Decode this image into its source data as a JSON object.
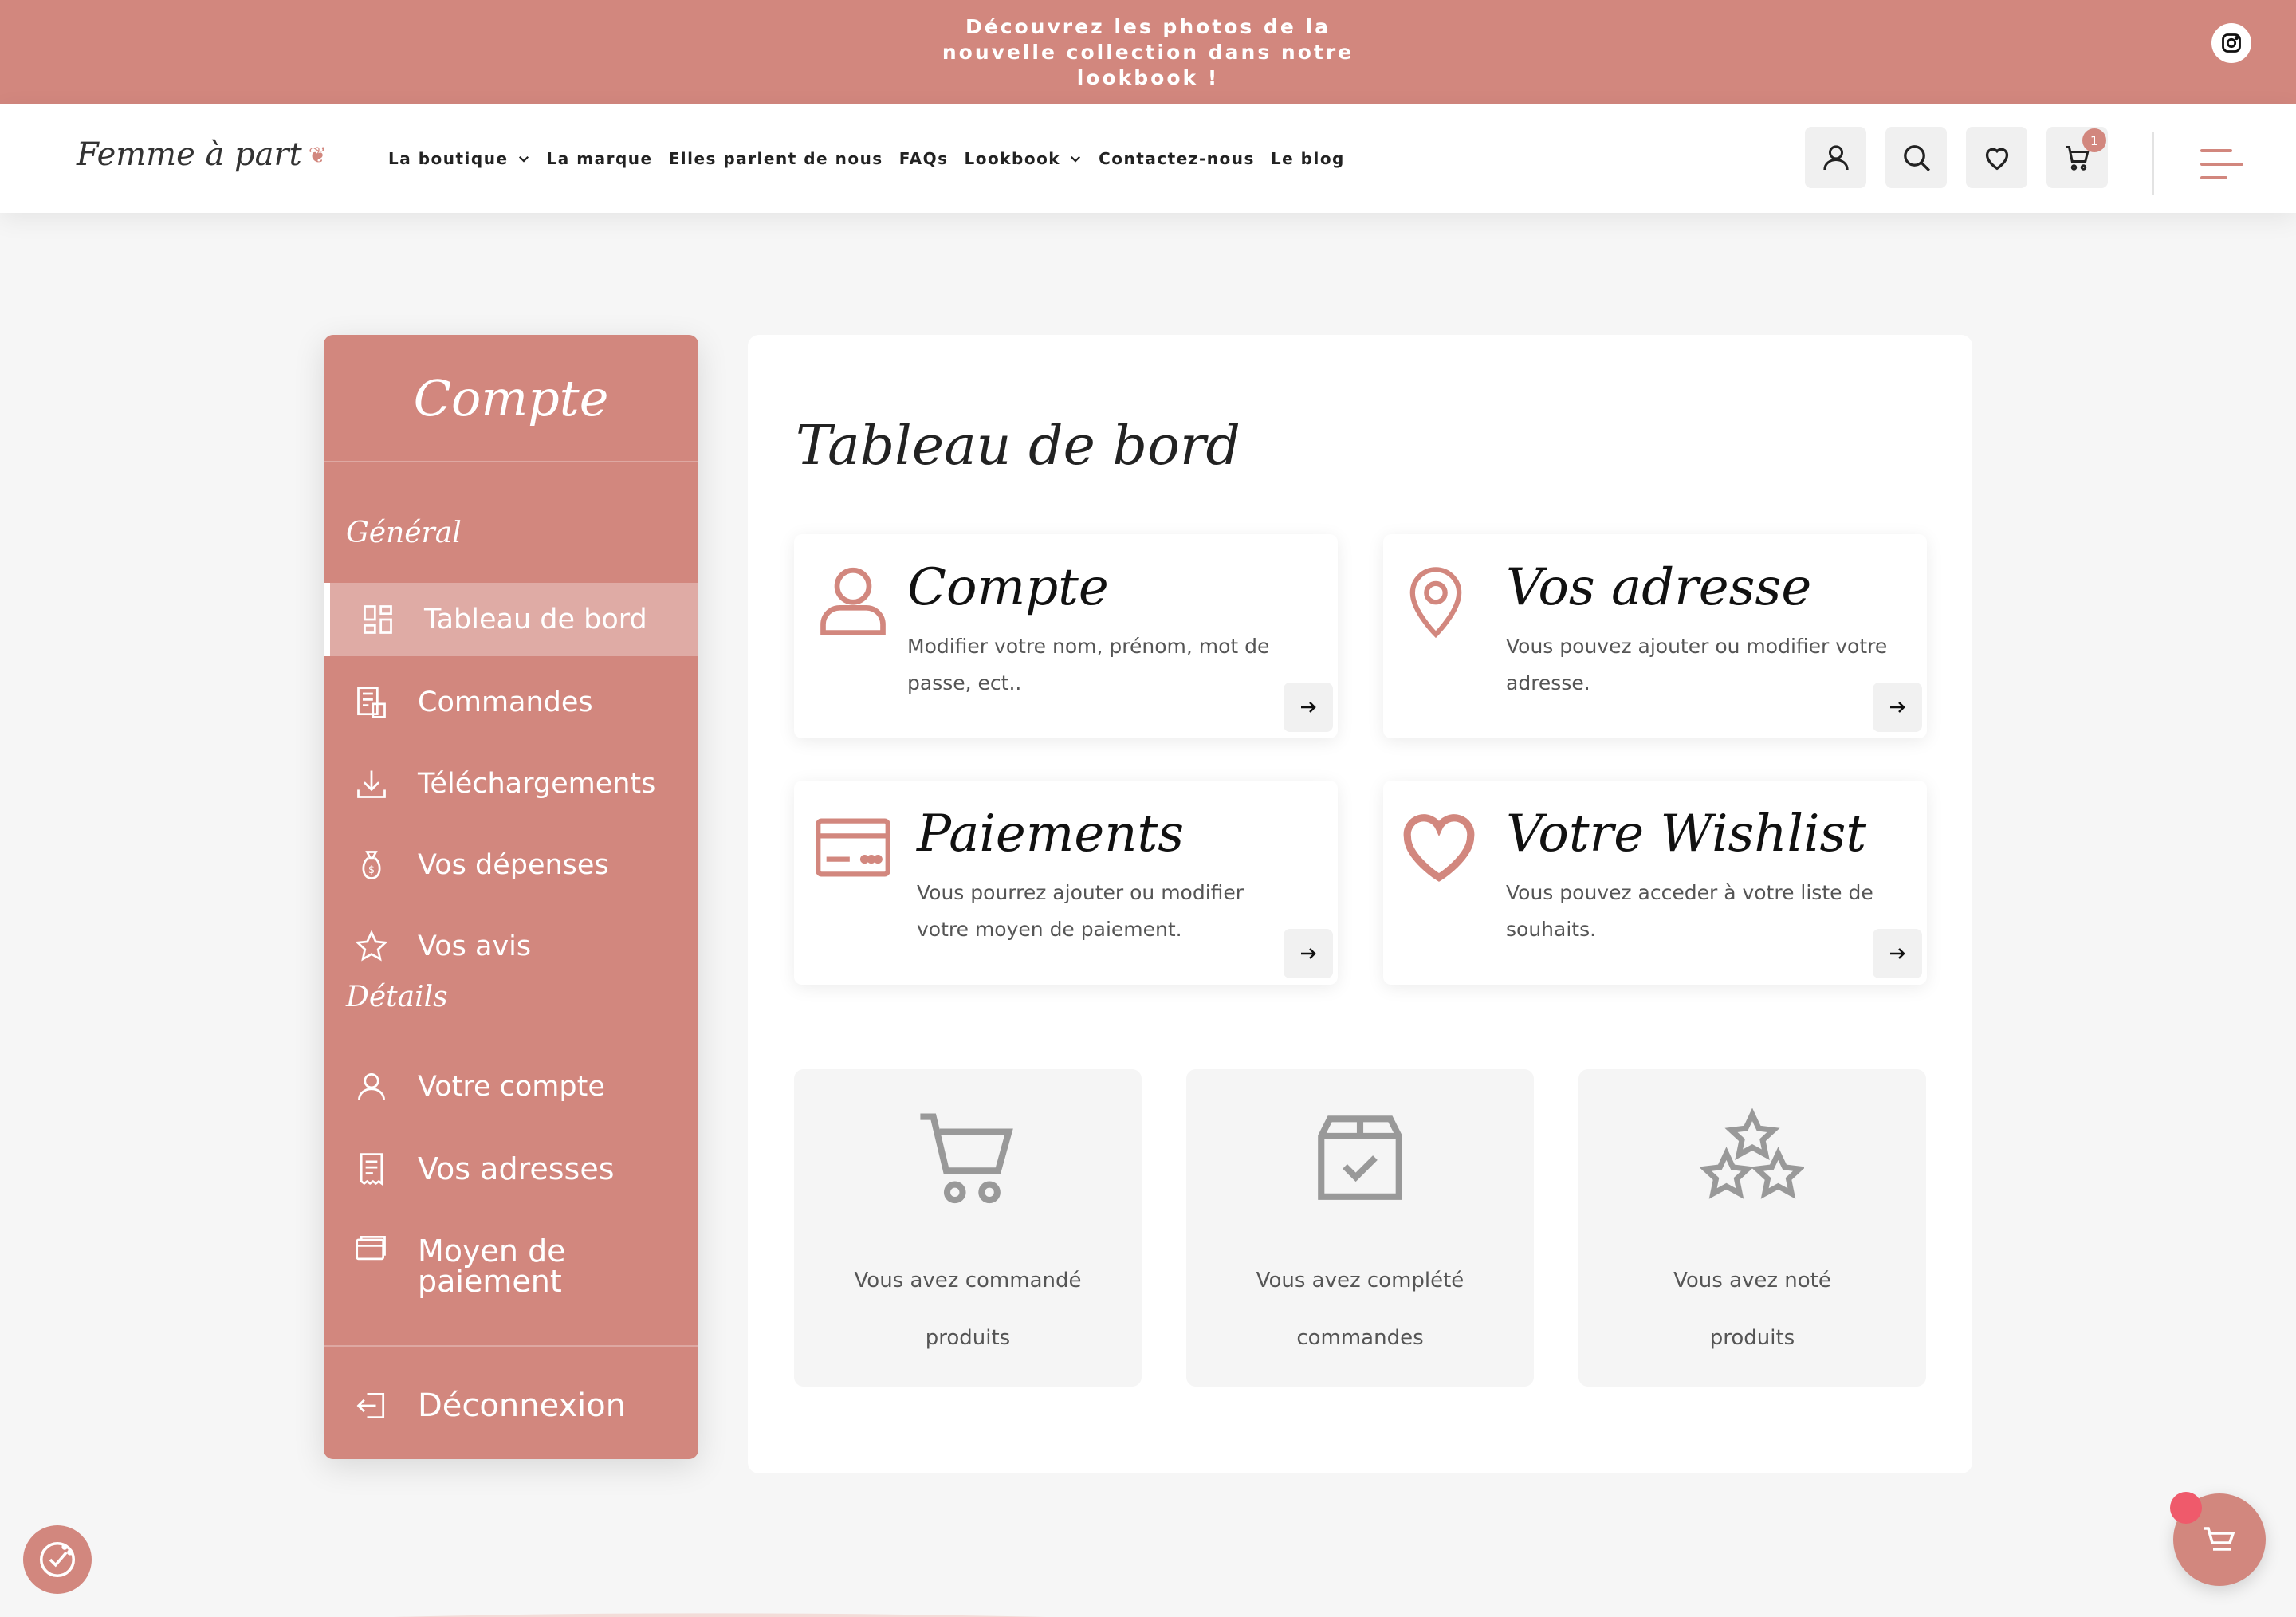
{
  "banner": {
    "text": "Découvrez les photos de la nouvelle collection dans notre lookbook !"
  },
  "header": {
    "logo": "Femme à part",
    "nav": [
      {
        "label": "La boutique"
      },
      {
        "label": "La marque"
      },
      {
        "label": "Elles parlent de nous"
      },
      {
        "label": "FAQs"
      },
      {
        "label": "Lookbook"
      },
      {
        "label": "Contactez-nous"
      },
      {
        "label": "Le blog"
      }
    ],
    "cart_count": "1"
  },
  "sidebar": {
    "title": "Compte",
    "section_general": "Général",
    "section_details": "Détails",
    "items": [
      {
        "label": "Tableau de bord"
      },
      {
        "label": "Commandes"
      },
      {
        "label": "Téléchargements"
      },
      {
        "label": "Vos dépenses"
      },
      {
        "label": "Vos avis"
      },
      {
        "label": "Votre compte"
      },
      {
        "label": "Vos adresses"
      },
      {
        "label": "Moyen de paiement"
      },
      {
        "label": "Déconnexion"
      }
    ]
  },
  "main": {
    "title": "Tableau de bord",
    "cards": [
      {
        "title": "Compte",
        "desc": "Modifier votre nom, prénom, mot de passe, ect.."
      },
      {
        "title": "Vos adresse",
        "desc": "Vous pouvez ajouter ou modifier votre adresse."
      },
      {
        "title": "Paiements",
        "desc": "Vous pourrez ajouter ou modifier votre moyen de paiement."
      },
      {
        "title": "Votre Wishlist",
        "desc": "Vous pouvez acceder à votre liste de souhaits."
      }
    ],
    "stats": [
      {
        "line1": "Vous avez commandé",
        "line2": "produits"
      },
      {
        "line1": "Vous avez complété",
        "line2": "commandes"
      },
      {
        "line1": "Vous avez noté",
        "line2": "produits"
      }
    ]
  },
  "colors": {
    "accent": "#d2877e",
    "background": "#f6f6f6"
  }
}
